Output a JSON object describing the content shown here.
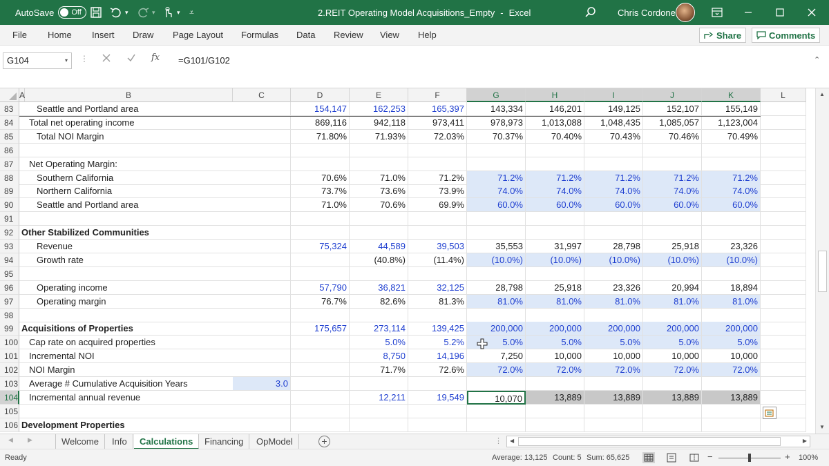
{
  "titlebar": {
    "autosave_label": "AutoSave",
    "autosave_state": "Off",
    "doc_title": "2.REIT Operating Model Acquisitions_Empty",
    "separator": "-",
    "app_name": "Excel",
    "user_name": "Chris Cordone"
  },
  "ribbon": {
    "tabs": [
      "File",
      "Home",
      "Insert",
      "Draw",
      "Page Layout",
      "Formulas",
      "Data",
      "Review",
      "View",
      "Help"
    ],
    "share_label": "Share",
    "comments_label": "Comments"
  },
  "formula": {
    "namebox": "G104",
    "fx_label": "fx",
    "content": "=G101/G102"
  },
  "columns": [
    "A",
    "B",
    "C",
    "D",
    "E",
    "F",
    "G",
    "H",
    "I",
    "J",
    "K",
    "L"
  ],
  "rows": [
    {
      "n": "83",
      "b": "Seattle and Portland area",
      "indent": 2,
      "c": "",
      "d": "154,147",
      "e": "162,253",
      "f": "165,397",
      "g": "143,334",
      "h": "146,201",
      "i": "149,125",
      "j": "152,107",
      "k": "155,149",
      "style": "blue-def"
    },
    {
      "n": "84",
      "b": "Total net operating income",
      "indent": 1,
      "c": "",
      "d": "869,116",
      "e": "942,118",
      "f": "973,411",
      "g": "978,973",
      "h": "1,013,088",
      "i": "1,048,435",
      "j": "1,085,057",
      "k": "1,123,004",
      "style": "black"
    },
    {
      "n": "85",
      "b": "Total NOI Margin",
      "indent": 2,
      "c": "",
      "d": "71.80%",
      "e": "71.93%",
      "f": "72.03%",
      "g": "70.37%",
      "h": "70.40%",
      "i": "70.43%",
      "j": "70.46%",
      "k": "70.49%",
      "style": "black"
    },
    {
      "n": "86",
      "b": "",
      "indent": 0,
      "c": "",
      "d": "",
      "e": "",
      "f": "",
      "g": "",
      "h": "",
      "i": "",
      "j": "",
      "k": "",
      "style": "black"
    },
    {
      "n": "87",
      "b": "Net Operating Margin:",
      "indent": 1,
      "c": "",
      "d": "",
      "e": "",
      "f": "",
      "g": "",
      "h": "",
      "i": "",
      "j": "",
      "k": "",
      "style": "black"
    },
    {
      "n": "88",
      "b": "Southern California",
      "indent": 2,
      "c": "",
      "d": "70.6%",
      "e": "71.0%",
      "f": "71.2%",
      "g": "71.2%",
      "h": "71.2%",
      "i": "71.2%",
      "j": "71.2%",
      "k": "71.2%",
      "style": "input-proj"
    },
    {
      "n": "89",
      "b": "Northern California",
      "indent": 2,
      "c": "",
      "d": "73.7%",
      "e": "73.6%",
      "f": "73.9%",
      "g": "74.0%",
      "h": "74.0%",
      "i": "74.0%",
      "j": "74.0%",
      "k": "74.0%",
      "style": "input-proj"
    },
    {
      "n": "90",
      "b": "Seattle and Portland area",
      "indent": 2,
      "c": "",
      "d": "71.0%",
      "e": "70.6%",
      "f": "69.9%",
      "g": "60.0%",
      "h": "60.0%",
      "i": "60.0%",
      "j": "60.0%",
      "k": "60.0%",
      "style": "input-proj"
    },
    {
      "n": "91",
      "b": "",
      "indent": 0,
      "c": "",
      "d": "",
      "e": "",
      "f": "",
      "g": "",
      "h": "",
      "i": "",
      "j": "",
      "k": "",
      "style": "black"
    },
    {
      "n": "92",
      "b": "Other Stabilized Communities",
      "indent": 0,
      "c": "",
      "d": "",
      "e": "",
      "f": "",
      "g": "",
      "h": "",
      "i": "",
      "j": "",
      "k": "",
      "style": "header"
    },
    {
      "n": "93",
      "b": "Revenue",
      "indent": 2,
      "c": "",
      "d": "75,324",
      "e": "44,589",
      "f": "39,503",
      "g": "35,553",
      "h": "31,997",
      "i": "28,798",
      "j": "25,918",
      "k": "23,326",
      "style": "blue-def"
    },
    {
      "n": "94",
      "b": "Growth rate",
      "indent": 2,
      "c": "",
      "d": "",
      "e": "(40.8%)",
      "f": "(11.4%)",
      "g": "(10.0%)",
      "h": "(10.0%)",
      "i": "(10.0%)",
      "j": "(10.0%)",
      "k": "(10.0%)",
      "style": "input-proj"
    },
    {
      "n": "95",
      "b": "",
      "indent": 0,
      "c": "",
      "d": "",
      "e": "",
      "f": "",
      "g": "",
      "h": "",
      "i": "",
      "j": "",
      "k": "",
      "style": "black"
    },
    {
      "n": "96",
      "b": "Operating income",
      "indent": 2,
      "c": "",
      "d": "57,790",
      "e": "36,821",
      "f": "32,125",
      "g": "28,798",
      "h": "25,918",
      "i": "23,326",
      "j": "20,994",
      "k": "18,894",
      "style": "blue-def"
    },
    {
      "n": "97",
      "b": "Operating margin",
      "indent": 2,
      "c": "",
      "d": "76.7%",
      "e": "82.6%",
      "f": "81.3%",
      "g": "81.0%",
      "h": "81.0%",
      "i": "81.0%",
      "j": "81.0%",
      "k": "81.0%",
      "style": "input-proj"
    },
    {
      "n": "98",
      "b": "",
      "indent": 0,
      "c": "",
      "d": "",
      "e": "",
      "f": "",
      "g": "",
      "h": "",
      "i": "",
      "j": "",
      "k": "",
      "style": "black"
    },
    {
      "n": "99",
      "b": "Acquisitions of Properties",
      "indent": 0,
      "c": "",
      "d": "175,657",
      "e": "273,114",
      "f": "139,425",
      "g": "200,000",
      "h": "200,000",
      "i": "200,000",
      "j": "200,000",
      "k": "200,000",
      "style": "acq"
    },
    {
      "n": "100",
      "b": "Cap rate on acquired properties",
      "indent": 1,
      "c": "",
      "d": "",
      "e": "5.0%",
      "f": "5.2%",
      "g": "5.0%",
      "h": "5.0%",
      "i": "5.0%",
      "j": "5.0%",
      "k": "5.0%",
      "style": "acq-cap"
    },
    {
      "n": "101",
      "b": "Incremental NOI",
      "indent": 1,
      "c": "",
      "d": "",
      "e": "8,750",
      "f": "14,196",
      "g": "7,250",
      "h": "10,000",
      "i": "10,000",
      "j": "10,000",
      "k": "10,000",
      "style": "blue-def"
    },
    {
      "n": "102",
      "b": "NOI Margin",
      "indent": 1,
      "c": "",
      "d": "",
      "e": "71.7%",
      "f": "72.6%",
      "g": "72.0%",
      "h": "72.0%",
      "i": "72.0%",
      "j": "72.0%",
      "k": "72.0%",
      "style": "input-proj"
    },
    {
      "n": "103",
      "b": "Average # Cumulative Acquisition Years",
      "indent": 1,
      "c": "3.0",
      "d": "",
      "e": "",
      "f": "",
      "g": "",
      "h": "",
      "i": "",
      "j": "",
      "k": "",
      "style": "c-input"
    },
    {
      "n": "104",
      "b": "Incremental annual revenue",
      "indent": 1,
      "c": "",
      "d": "",
      "e": "12,211",
      "f": "19,549",
      "g": "10,070",
      "h": "13,889",
      "i": "13,889",
      "j": "13,889",
      "k": "13,889",
      "style": "selected"
    },
    {
      "n": "105",
      "b": "",
      "indent": 0,
      "c": "",
      "d": "",
      "e": "",
      "f": "",
      "g": "",
      "h": "",
      "i": "",
      "j": "",
      "k": "",
      "style": "black"
    },
    {
      "n": "106",
      "b": "Development Properties",
      "indent": 0,
      "c": "",
      "d": "",
      "e": "",
      "f": "",
      "g": "",
      "h": "",
      "i": "",
      "j": "",
      "k": "",
      "style": "header"
    }
  ],
  "sheets": [
    "Welcome",
    "Info",
    "Calculations",
    "Financing",
    "OpModel"
  ],
  "active_sheet": "Calculations",
  "status": {
    "ready": "Ready",
    "average": "Average: 13,125",
    "count": "Count: 5",
    "sum": "Sum: 65,625",
    "zoom": "100%"
  },
  "colors": {
    "excel_green": "#217346",
    "input_blue": "#1f3fd0",
    "projection_fill": "#dde8f8"
  }
}
